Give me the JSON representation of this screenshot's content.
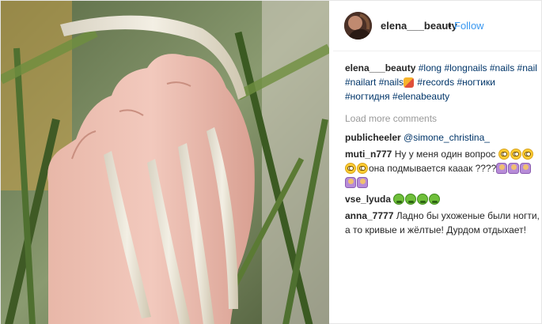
{
  "post": {
    "username": "elena___beauty",
    "separator": "•",
    "follow_label": "Follow"
  },
  "caption": {
    "username": "elena___beauty",
    "tags_line1": [
      "#long",
      "#longnails",
      "#nails",
      "#nail"
    ],
    "tags_line2_a": [
      "#nailart",
      "#nails"
    ],
    "tags_line2_b": [
      "#records",
      "#ногтики"
    ],
    "tags_line3": [
      "#ногтидня",
      "#elenabeauty"
    ]
  },
  "load_more": "Load more comments",
  "comments": [
    {
      "user": "publicheeler",
      "mention": "@simone_christina_"
    },
    {
      "user": "muti_n777",
      "text_a": "Ну у меня один вопрос",
      "text_b": "она подмывается кааак ????"
    },
    {
      "user": "vse_lyuda"
    },
    {
      "user": "anna_7777",
      "text": "Ладно бы ухоженые были ногти, а то кривые и жёлтые! Дурдом отдыхает!"
    }
  ],
  "icons": {
    "avatar": "avatar-image",
    "rolling_eyes": "rolling-eyes-icon",
    "sick_face": "sick-face-icon",
    "woman_gesture": "woman-gesture-icon",
    "nail_polish": "nail-polish-icon"
  }
}
